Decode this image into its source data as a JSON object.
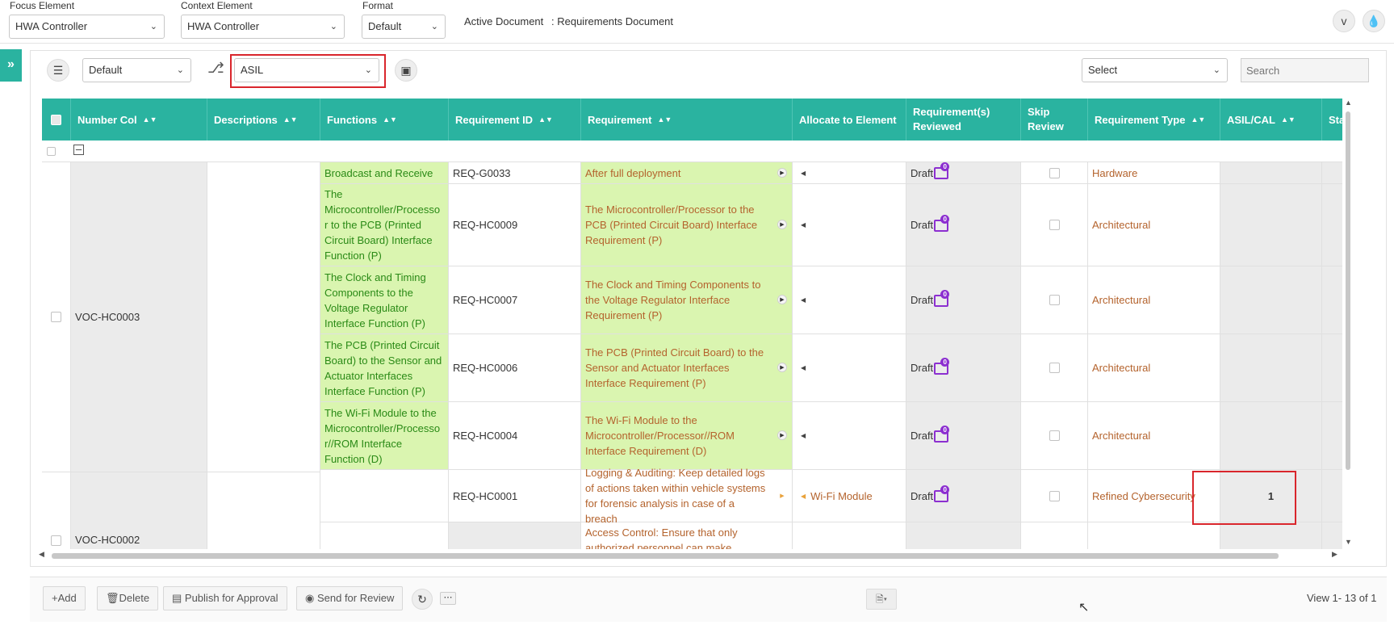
{
  "toolbar": {
    "focus": {
      "label": "Focus Element",
      "value": "HWA Controller"
    },
    "context": {
      "label": "Context Element",
      "value": "HWA Controller"
    },
    "format": {
      "label": "Format",
      "value": "Default"
    },
    "active_doc_label": "Active Document",
    "active_doc_value": ": Requirements Document"
  },
  "panel": {
    "view_select": "Default",
    "attribute_select": "ASIL",
    "right_select": "Select",
    "search_placeholder": "Search"
  },
  "grid": {
    "columns": [
      "Number Col",
      "Descriptions",
      "Functions",
      "Requirement ID",
      "Requirement",
      "Allocate to Element",
      "Requirement(s) Reviewed",
      "Skip Review",
      "Requirement Type",
      "ASIL/CAL",
      "Status"
    ],
    "groups": [
      {
        "number": "VOC-HC0003"
      },
      {
        "number": "VOC-HC0002"
      }
    ],
    "rows": [
      {
        "function": "Broadcast and Receive",
        "req_id": "REQ-G0033",
        "requirement": "After full deployment",
        "allocate": "",
        "reviewed": "Draft",
        "comments": "0",
        "req_type": "Hardware",
        "asil": ""
      },
      {
        "function": "The Microcontroller/Processo r to the PCB (Printed Circuit Board) Interface Function (P)",
        "req_id": "REQ-HC0009",
        "requirement": "The Microcontroller/Processor to the PCB (Printed Circuit Board) Interface Requirement (P)",
        "allocate": "",
        "reviewed": "Draft",
        "comments": "0",
        "req_type": "Architectural",
        "asil": ""
      },
      {
        "function": "The Clock and Timing Components to the Voltage Regulator Interface Function (P)",
        "req_id": "REQ-HC0007",
        "requirement": "The Clock and Timing Components to the Voltage Regulator Interface Requirement (P)",
        "allocate": "",
        "reviewed": "Draft",
        "comments": "0",
        "req_type": "Architectural",
        "asil": ""
      },
      {
        "function": "The PCB (Printed Circuit Board) to the Sensor and Actuator Interfaces Interface Function (P)",
        "req_id": "REQ-HC0006",
        "requirement": "The PCB (Printed Circuit Board) to the Sensor and Actuator Interfaces Interface Requirement (P)",
        "allocate": "",
        "reviewed": "Draft",
        "comments": "0",
        "req_type": "Architectural",
        "asil": ""
      },
      {
        "function": "The Wi-Fi Module to the Microcontroller/Processo r//ROM Interface Function (D)",
        "req_id": "REQ-HC0004",
        "requirement": "The Wi-Fi Module to the Microcontroller/Processor//ROM Interface Requirement (D)",
        "allocate": "",
        "reviewed": "Draft",
        "comments": "0",
        "req_type": "Architectural",
        "asil": ""
      },
      {
        "function": "",
        "req_id": "REQ-HC0001",
        "requirement": "Logging & Auditing: Keep detailed logs of actions taken within vehicle systems for forensic analysis in case of a breach",
        "allocate": "Wi-Fi Module",
        "reviewed": "Draft",
        "comments": "0",
        "req_type": "Refined Cybersecurity",
        "asil": "1"
      },
      {
        "function": "",
        "req_id": "",
        "requirement": "Access Control: Ensure that only authorized personnel can make",
        "allocate": "",
        "reviewed": "",
        "comments": "",
        "req_type": "",
        "asil": ""
      }
    ]
  },
  "footer": {
    "add": "Add",
    "delete": "Delete",
    "publish": "Publish for Approval",
    "send_review": "Send for Review",
    "view_count": "View 1- 13 of 1"
  },
  "colors": {
    "accent": "#2ab3a0",
    "highlight": "#d9262c",
    "green_cell": "#daf5b0",
    "req_text": "#b4632d",
    "func_text": "#2a8a16",
    "badge": "#8c2fd0"
  }
}
